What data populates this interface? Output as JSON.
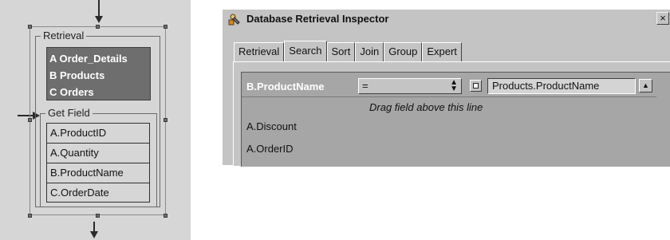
{
  "node": {
    "retrieval_label": "Retrieval",
    "tables": [
      "A Order_Details",
      "B Products",
      "C Orders"
    ],
    "get_field_label": "Get Field",
    "fields": [
      "A.ProductID",
      "A.Quantity",
      "B.ProductName",
      "C.OrderDate"
    ]
  },
  "dialog": {
    "title": "Database Retrieval Inspector",
    "close_label": "×",
    "tabs": [
      "Retrieval",
      "Search",
      "Sort",
      "Join",
      "Group",
      "Expert"
    ],
    "active_tab": "Search",
    "criteria_row": {
      "field": "B.ProductName",
      "operator": "=",
      "value": "Products.ProductName"
    },
    "drag_hint": "Drag field above this line",
    "available_fields": [
      "A.Discount",
      "A.OrderID"
    ]
  },
  "colors": {
    "canvas_bg": "#d6d6d6",
    "tables_box_bg": "#6e6e6e",
    "dialog_bg": "#c4c4c4",
    "grid_bg": "#a6a6a6"
  }
}
